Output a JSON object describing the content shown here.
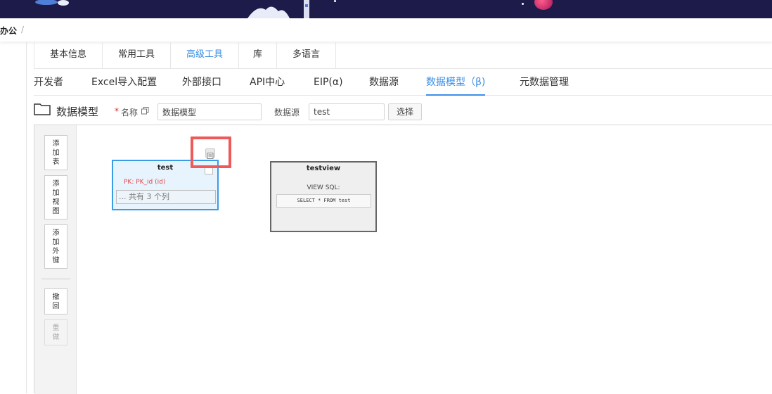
{
  "breadcrumb": {
    "current": "办公",
    "separator": "/"
  },
  "tabs_primary": [
    {
      "label": "基本信息",
      "active": false
    },
    {
      "label": "常用工具",
      "active": false
    },
    {
      "label": "高级工具",
      "active": true
    },
    {
      "label": "库",
      "active": false
    },
    {
      "label": "多语言",
      "active": false
    }
  ],
  "tabs_secondary": [
    {
      "label": "开发者",
      "active": false
    },
    {
      "label": "Excel导入配置",
      "active": false
    },
    {
      "label": "外部接口",
      "active": false
    },
    {
      "label": "API中心",
      "active": false
    },
    {
      "label": "EIP(α)",
      "active": false
    },
    {
      "label": "数据源",
      "active": false
    },
    {
      "label": "数据模型（β)",
      "active": true
    },
    {
      "label": "元数据管理",
      "active": false
    }
  ],
  "form": {
    "page_title": "数据模型",
    "required_mark": "*",
    "name_label": "名称",
    "name_value": "数据模型",
    "source_label": "数据源",
    "source_value": "test",
    "select_button": "选择"
  },
  "toolbar": {
    "add_table": [
      "添",
      "加",
      "表"
    ],
    "add_view": [
      "添",
      "加",
      "视",
      "图"
    ],
    "add_fk": [
      "添",
      "加",
      "外",
      "键"
    ],
    "undo": [
      "撤",
      "回"
    ],
    "redo": [
      "重",
      "做"
    ]
  },
  "nodes": {
    "test": {
      "title": "test",
      "pk": "PK: PK_id (id)",
      "columns_summary": "... 共有 3 个列"
    },
    "testview": {
      "title": "testview",
      "view_label": "VIEW SQL:",
      "sql": "SELECT * FROM test"
    }
  },
  "colors": {
    "accent": "#3a8ee6",
    "highlight": "#ee5a5a",
    "pk": "#e0474c",
    "banner": "#1c1b4a"
  }
}
